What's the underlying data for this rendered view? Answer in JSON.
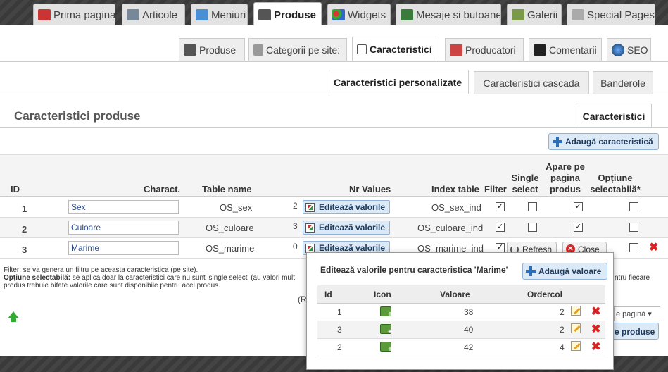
{
  "top_tabs": [
    {
      "label": "Prima pagina",
      "icon": "home-icon"
    },
    {
      "label": "Articole",
      "icon": "articles-icon"
    },
    {
      "label": "Meniuri",
      "icon": "menus-icon"
    },
    {
      "label": "Produse",
      "icon": "products-icon"
    },
    {
      "label": "Widgets",
      "icon": "widgets-icon"
    },
    {
      "label": "Mesaje si butoane",
      "icon": "messages-icon"
    },
    {
      "label": "Galerii",
      "icon": "gallery-icon"
    },
    {
      "label": "Special Pages",
      "icon": "special-pages-icon"
    }
  ],
  "sub_tabs": [
    {
      "label": "Produse",
      "icon": "products-icon"
    },
    {
      "label": "Categorii pe site:",
      "icon": "categories-icon"
    },
    {
      "label": "Caracteristici",
      "icon": "characteristics-icon"
    },
    {
      "label": "Producatori",
      "icon": "factory-icon"
    },
    {
      "label": "Comentarii",
      "icon": "comments-icon"
    },
    {
      "label": "SEO",
      "icon": "globe-icon"
    }
  ],
  "third_tabs": [
    {
      "label": "Caracteristici personalizate"
    },
    {
      "label": "Caracteristici cascada"
    },
    {
      "label": "Banderole"
    }
  ],
  "section": {
    "title": "Caracteristici produse",
    "right_tab": "Caracteristici",
    "add_button": "Adaugă caracteristică"
  },
  "table": {
    "headers": {
      "id": "ID",
      "charact": "Charact.",
      "table_name": "Table name",
      "nr_values": "Nr Values",
      "index_table": "Index table",
      "filter": "Filter",
      "single_select": "Single select",
      "apare": "Apare pe pagina produs",
      "optiune": "Opțiune selectabilă*"
    },
    "edit_label": "Editează valorile",
    "rows": [
      {
        "id": "1",
        "charact": "Sex",
        "table": "OS_sex",
        "nr": "2",
        "index": "OS_sex_ind",
        "filter": "✓",
        "single": "",
        "apare": "✓",
        "optiune": ""
      },
      {
        "id": "2",
        "charact": "Culoare",
        "table": "OS_culoare",
        "nr": "3",
        "index": "OS_culoare_ind",
        "filter": "✓",
        "single": "",
        "apare": "✓",
        "optiune": ""
      },
      {
        "id": "3",
        "charact": "Marime",
        "table": "OS_marime",
        "nr": "0",
        "index": "OS_marime_ind",
        "filter": "✓",
        "single": "",
        "apare": "",
        "optiune": ""
      }
    ]
  },
  "notes": {
    "line1": "Filter: se va genera un filtru pe aceasta caracteristica (pe site).",
    "line2_bold": "Opțiune selectabilă:",
    "line2": " se aplica doar la caracteristici care nu sunt 'single select' (au valori mult",
    "line3": "produs trebuie bifate valorile care sunt disponibile pentru acel produs.",
    "right_fragment": "ntru fiecare",
    "r_fragment": "(R",
    "select_fragment": "e pagină",
    "button_fragment": "e produse"
  },
  "popup": {
    "refresh": "Refresh",
    "close": "Close",
    "title": "Editează valorile pentru caracteristica 'Marime'",
    "add_value": "Adaugă valoare",
    "headers": {
      "id": "Id",
      "icon": "Icon",
      "valoare": "Valoare",
      "ordercol": "Ordercol"
    },
    "rows": [
      {
        "id": "1",
        "valoare": "38",
        "ordercol": "2"
      },
      {
        "id": "3",
        "valoare": "40",
        "ordercol": "2"
      },
      {
        "id": "2",
        "valoare": "42",
        "ordercol": "4"
      }
    ]
  }
}
